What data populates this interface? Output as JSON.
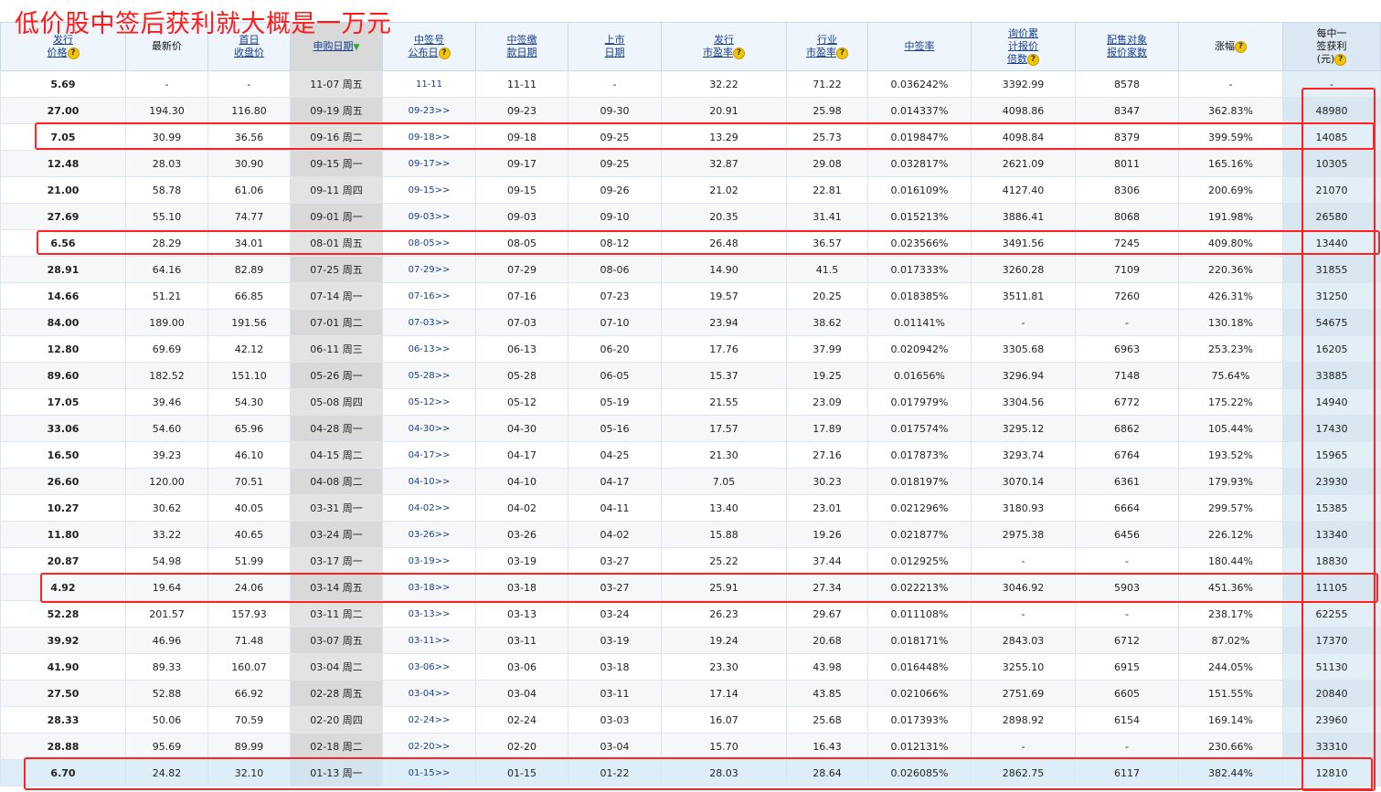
{
  "annotation": {
    "title": "低价股中签后获利就大概是一万元"
  },
  "headers": [
    {
      "l1": "发行",
      "l2": "价格",
      "link": true,
      "help": true
    },
    {
      "l1": "最新价",
      "l2": "",
      "link": false,
      "help": false
    },
    {
      "l1": "首日",
      "l2": "收盘价",
      "link": true,
      "help": false
    },
    {
      "l1": "申购日期",
      "l2": "",
      "link": true,
      "help": false,
      "sort": true
    },
    {
      "l1": "中签号",
      "l2": "公布日",
      "link": true,
      "help": true
    },
    {
      "l1": "中签缴",
      "l2": "款日期",
      "link": true,
      "help": false
    },
    {
      "l1": "上市",
      "l2": "日期",
      "link": true,
      "help": false
    },
    {
      "l1": "发行",
      "l2": "市盈率",
      "link": true,
      "help": true
    },
    {
      "l1": "行业",
      "l2": "市盈率",
      "link": true,
      "help": true
    },
    {
      "l1": "中签率",
      "l2": "",
      "link": true,
      "help": false
    },
    {
      "l1": "询价累",
      "l2": "计报价",
      "l3": "倍数",
      "link": true,
      "help": true
    },
    {
      "l1": "配售对象",
      "l2": "报价家数",
      "link": true,
      "help": false
    },
    {
      "l1": "涨幅",
      "l2": "",
      "link": false,
      "help": true
    },
    {
      "l1": "每中一",
      "l2": "签获利",
      "l3": "(元)",
      "link": false,
      "help": true
    }
  ],
  "help_glyph": "?",
  "sort_glyph": "▼",
  "rows": [
    [
      "5.69",
      "-",
      "-",
      "11-07 周五",
      "11-11",
      "11-11",
      "-",
      "32.22",
      "71.22",
      "0.036242%",
      "3392.99",
      "8578",
      "-",
      "-"
    ],
    [
      "27.00",
      "194.30",
      "116.80",
      "09-19 周五",
      "09-23>>",
      "09-23",
      "09-30",
      "20.91",
      "25.98",
      "0.014337%",
      "4098.86",
      "8347",
      "362.83%",
      "48980"
    ],
    [
      "7.05",
      "30.99",
      "36.56",
      "09-16 周二",
      "09-18>>",
      "09-18",
      "09-25",
      "13.29",
      "25.73",
      "0.019847%",
      "4098.84",
      "8379",
      "399.59%",
      "14085"
    ],
    [
      "12.48",
      "28.03",
      "30.90",
      "09-15 周一",
      "09-17>>",
      "09-17",
      "09-25",
      "32.87",
      "29.08",
      "0.032817%",
      "2621.09",
      "8011",
      "165.16%",
      "10305"
    ],
    [
      "21.00",
      "58.78",
      "61.06",
      "09-11 周四",
      "09-15>>",
      "09-15",
      "09-26",
      "21.02",
      "22.81",
      "0.016109%",
      "4127.40",
      "8306",
      "200.69%",
      "21070"
    ],
    [
      "27.69",
      "55.10",
      "74.77",
      "09-01 周一",
      "09-03>>",
      "09-03",
      "09-10",
      "20.35",
      "31.41",
      "0.015213%",
      "3886.41",
      "8068",
      "191.98%",
      "26580"
    ],
    [
      "6.56",
      "28.29",
      "34.01",
      "08-01 周五",
      "08-05>>",
      "08-05",
      "08-12",
      "26.48",
      "36.57",
      "0.023566%",
      "3491.56",
      "7245",
      "409.80%",
      "13440"
    ],
    [
      "28.91",
      "64.16",
      "82.89",
      "07-25 周五",
      "07-29>>",
      "07-29",
      "08-06",
      "14.90",
      "41.5",
      "0.017333%",
      "3260.28",
      "7109",
      "220.36%",
      "31855"
    ],
    [
      "14.66",
      "51.21",
      "66.85",
      "07-14 周一",
      "07-16>>",
      "07-16",
      "07-23",
      "19.57",
      "20.25",
      "0.018385%",
      "3511.81",
      "7260",
      "426.31%",
      "31250"
    ],
    [
      "84.00",
      "189.00",
      "191.56",
      "07-01 周二",
      "07-03>>",
      "07-03",
      "07-10",
      "23.94",
      "38.62",
      "0.01141%",
      "-",
      "-",
      "130.18%",
      "54675"
    ],
    [
      "12.80",
      "69.69",
      "42.12",
      "06-11 周三",
      "06-13>>",
      "06-13",
      "06-20",
      "17.76",
      "37.99",
      "0.020942%",
      "3305.68",
      "6963",
      "253.23%",
      "16205"
    ],
    [
      "89.60",
      "182.52",
      "151.10",
      "05-26 周一",
      "05-28>>",
      "05-28",
      "06-05",
      "15.37",
      "19.25",
      "0.01656%",
      "3296.94",
      "7148",
      "75.64%",
      "33885"
    ],
    [
      "17.05",
      "39.46",
      "54.30",
      "05-08 周四",
      "05-12>>",
      "05-12",
      "05-19",
      "21.55",
      "23.09",
      "0.017979%",
      "3304.56",
      "6772",
      "175.22%",
      "14940"
    ],
    [
      "33.06",
      "54.60",
      "65.96",
      "04-28 周一",
      "04-30>>",
      "04-30",
      "05-16",
      "17.57",
      "17.89",
      "0.017574%",
      "3295.12",
      "6862",
      "105.44%",
      "17430"
    ],
    [
      "16.50",
      "39.23",
      "46.10",
      "04-15 周二",
      "04-17>>",
      "04-17",
      "04-25",
      "21.30",
      "27.16",
      "0.017873%",
      "3293.74",
      "6764",
      "193.52%",
      "15965"
    ],
    [
      "26.60",
      "120.00",
      "70.51",
      "04-08 周二",
      "04-10>>",
      "04-10",
      "04-17",
      "7.05",
      "30.23",
      "0.018197%",
      "3070.14",
      "6361",
      "179.93%",
      "23930"
    ],
    [
      "10.27",
      "30.62",
      "40.05",
      "03-31 周一",
      "04-02>>",
      "04-02",
      "04-11",
      "13.40",
      "23.01",
      "0.021296%",
      "3180.93",
      "6664",
      "299.57%",
      "15385"
    ],
    [
      "11.80",
      "33.22",
      "40.65",
      "03-24 周一",
      "03-26>>",
      "03-26",
      "04-02",
      "15.88",
      "19.26",
      "0.021877%",
      "2975.38",
      "6456",
      "226.12%",
      "13340"
    ],
    [
      "20.87",
      "54.98",
      "51.99",
      "03-17 周一",
      "03-19>>",
      "03-19",
      "03-27",
      "25.22",
      "37.44",
      "0.012925%",
      "-",
      "-",
      "180.44%",
      "18830"
    ],
    [
      "4.92",
      "19.64",
      "24.06",
      "03-14 周五",
      "03-18>>",
      "03-18",
      "03-27",
      "25.91",
      "27.34",
      "0.022213%",
      "3046.92",
      "5903",
      "451.36%",
      "11105"
    ],
    [
      "52.28",
      "201.57",
      "157.93",
      "03-11 周二",
      "03-13>>",
      "03-13",
      "03-24",
      "26.23",
      "29.67",
      "0.011108%",
      "-",
      "-",
      "238.17%",
      "62255"
    ],
    [
      "39.92",
      "46.96",
      "71.48",
      "03-07 周五",
      "03-11>>",
      "03-11",
      "03-19",
      "19.24",
      "20.68",
      "0.018171%",
      "2843.03",
      "6712",
      "87.02%",
      "17370"
    ],
    [
      "41.90",
      "89.33",
      "160.07",
      "03-04 周二",
      "03-06>>",
      "03-06",
      "03-18",
      "23.30",
      "43.98",
      "0.016448%",
      "3255.10",
      "6915",
      "244.05%",
      "51130"
    ],
    [
      "27.50",
      "52.88",
      "66.92",
      "02-28 周五",
      "03-04>>",
      "03-04",
      "03-11",
      "17.14",
      "43.85",
      "0.021066%",
      "2751.69",
      "6605",
      "151.55%",
      "20840"
    ],
    [
      "28.33",
      "50.06",
      "70.59",
      "02-20 周四",
      "02-24>>",
      "02-24",
      "03-03",
      "16.07",
      "25.68",
      "0.017393%",
      "2898.92",
      "6154",
      "169.14%",
      "23960"
    ],
    [
      "28.88",
      "95.69",
      "89.99",
      "02-18 周二",
      "02-20>>",
      "02-20",
      "03-04",
      "15.70",
      "16.43",
      "0.012131%",
      "-",
      "-",
      "230.66%",
      "33310"
    ],
    [
      "6.70",
      "24.82",
      "32.10",
      "01-13 周一",
      "01-15>>",
      "01-15",
      "01-22",
      "28.03",
      "28.64",
      "0.026085%",
      "2862.75",
      "6117",
      "382.44%",
      "12810"
    ]
  ],
  "highlighted_rows": [
    2,
    6,
    19,
    26
  ]
}
